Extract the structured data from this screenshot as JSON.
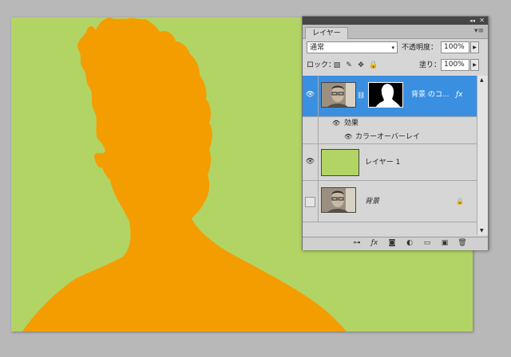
{
  "panel": {
    "collapse_glyph": "◂◂",
    "close_glyph": "✕",
    "tab_label": "レイヤー",
    "menu_glyph": "▾≡",
    "blend_mode": "通常",
    "blend_arrow": "▾",
    "opacity_label": "不透明度：",
    "opacity_value": "100%",
    "lock_label": "ロック：",
    "fill_label": "塗り：",
    "fill_value": "100%",
    "step_glyph": "▶",
    "lock_icons": {
      "transparent": "▨",
      "image": "✎",
      "position": "✥",
      "all": "🔒"
    }
  },
  "layers": [
    {
      "name": "背景 のコ...",
      "fx": "ƒx",
      "visible": true,
      "selected": true,
      "effects_label": "効果",
      "effect_item": "カラーオーバーレイ",
      "collapse_arrow": "▴"
    },
    {
      "name": "レイヤー 1",
      "visible": true,
      "selected": false,
      "color": "#b2d465"
    },
    {
      "name": "背景",
      "visible": false,
      "selected": false,
      "locked": true,
      "lock_glyph": "🔒"
    }
  ],
  "icons": {
    "eye": "👁",
    "scroll_up": "▲",
    "scroll_down": "▼",
    "footer": [
      "⊶",
      "ƒx",
      "◙",
      "◐",
      "▭",
      "▣",
      "🗑"
    ]
  },
  "colors": {
    "canvas_bg": "#b2d465",
    "silhouette": "#f49d00",
    "selection": "#3a8fe0",
    "mask_bg": "#000000"
  }
}
